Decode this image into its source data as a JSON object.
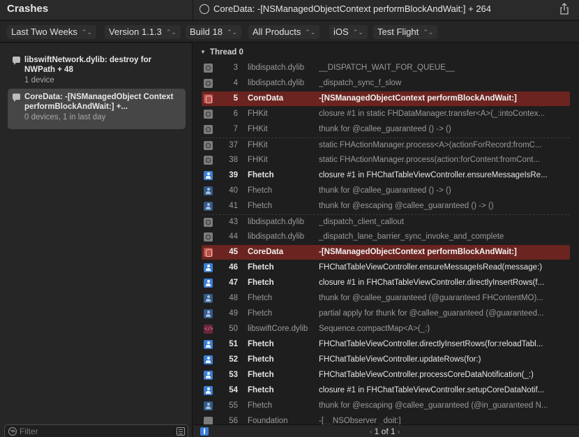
{
  "titlebar": {
    "sidebar_title": "Crashes",
    "crash_title": "CoreData: -[NSManagedObjectContext performBlockAndWait:] + 264"
  },
  "filters": [
    {
      "label": "Last Two Weeks"
    },
    {
      "label": "Version 1.1.3"
    },
    {
      "label": "Build 18"
    },
    {
      "label": "All Products"
    },
    {
      "label": "iOS"
    },
    {
      "label": "Test Flight"
    }
  ],
  "sidebar": {
    "items": [
      {
        "name": "libswiftNetwork.dylib: destroy for NWPath + 48",
        "meta": "1 device",
        "selected": false
      },
      {
        "name": "CoreData: -[NSManagedObject Context performBlockAndWait:] +...",
        "meta": "0 devices, 1 in last day",
        "selected": true
      }
    ],
    "filter_placeholder": "Filter"
  },
  "thread": {
    "title": "Thread 0",
    "frames": [
      {
        "icon": "gear",
        "num": "3",
        "lib": "libdispatch.dylib",
        "sym": "__DISPATCH_WAIT_FOR_QUEUE__",
        "style": "gray"
      },
      {
        "icon": "gear",
        "num": "4",
        "lib": "libdispatch.dylib",
        "sym": "_dispatch_sync_f_slow",
        "style": "gray"
      },
      {
        "icon": "db",
        "num": "5",
        "lib": "CoreData",
        "sym": "-[NSManagedObjectContext performBlockAndWait:]",
        "style": "hl"
      },
      {
        "icon": "gear",
        "num": "6",
        "lib": "FHKit",
        "sym": "closure #1 in static FHDataManager.transfer<A>(_:intoContex...",
        "style": "gray"
      },
      {
        "icon": "gear",
        "num": "7",
        "lib": "FHKit",
        "sym": "thunk for @callee_guaranteed () -> ()",
        "style": "gray"
      },
      {
        "icon": "gear",
        "num": "37",
        "lib": "FHKit",
        "sym": "static FHActionManager.process<A>(actionForRecord:fromC...",
        "style": "gray",
        "sep": true
      },
      {
        "icon": "gear",
        "num": "38",
        "lib": "FHKit",
        "sym": "static FHActionManager.process(action:forContent:fromCont...",
        "style": "gray"
      },
      {
        "icon": "user",
        "num": "39",
        "lib": "Fhetch",
        "sym": "closure #1 in FHChatTableViewController.ensureMessageIsRe...",
        "style": "bright"
      },
      {
        "icon": "user-dim",
        "num": "40",
        "lib": "Fhetch",
        "sym": "thunk for @callee_guaranteed () -> ()",
        "style": "gray"
      },
      {
        "icon": "user-dim",
        "num": "41",
        "lib": "Fhetch",
        "sym": "thunk for @escaping @callee_guaranteed () -> ()",
        "style": "gray"
      },
      {
        "icon": "gear",
        "num": "43",
        "lib": "libdispatch.dylib",
        "sym": "_dispatch_client_callout",
        "style": "gray",
        "sep": true
      },
      {
        "icon": "gear",
        "num": "44",
        "lib": "libdispatch.dylib",
        "sym": "_dispatch_lane_barrier_sync_invoke_and_complete",
        "style": "gray"
      },
      {
        "icon": "db",
        "num": "45",
        "lib": "CoreData",
        "sym": "-[NSManagedObjectContext performBlockAndWait:]",
        "style": "hl"
      },
      {
        "icon": "user",
        "num": "46",
        "lib": "Fhetch",
        "sym": "FHChatTableViewController.ensureMessageIsRead(message:)",
        "style": "bright"
      },
      {
        "icon": "user",
        "num": "47",
        "lib": "Fhetch",
        "sym": "closure #1 in FHChatTableViewController.directlyInsertRows(f...",
        "style": "bright"
      },
      {
        "icon": "user-dim",
        "num": "48",
        "lib": "Fhetch",
        "sym": "thunk for @callee_guaranteed (@guaranteed FHContentMO)...",
        "style": "gray"
      },
      {
        "icon": "user-dim",
        "num": "49",
        "lib": "Fhetch",
        "sym": "partial apply for thunk for @callee_guaranteed (@guaranteed...",
        "style": "gray"
      },
      {
        "icon": "swift",
        "num": "50",
        "lib": "libswiftCore.dylib",
        "sym": "Sequence.compactMap<A>(_:)",
        "style": "gray"
      },
      {
        "icon": "user",
        "num": "51",
        "lib": "Fhetch",
        "sym": "FHChatTableViewController.directlyInsertRows(for:reloadTabl...",
        "style": "bright"
      },
      {
        "icon": "user",
        "num": "52",
        "lib": "Fhetch",
        "sym": "FHChatTableViewController.updateRows(for:)",
        "style": "bright"
      },
      {
        "icon": "user",
        "num": "53",
        "lib": "Fhetch",
        "sym": "FHChatTableViewController.processCoreDataNotification(_:)",
        "style": "bright"
      },
      {
        "icon": "user",
        "num": "54",
        "lib": "Fhetch",
        "sym": "closure #1 in FHChatTableViewController.setupCoreDataNotif...",
        "style": "bright"
      },
      {
        "icon": "user-dim",
        "num": "55",
        "lib": "Fhetch",
        "sym": "thunk for @escaping @callee_guaranteed (@in_guaranteed N...",
        "style": "gray"
      },
      {
        "icon": "folder",
        "num": "56",
        "lib": "Foundation",
        "sym": "-[__NSObserver _doit:]",
        "style": "gray"
      }
    ]
  },
  "pager": {
    "text": "1 of 1"
  }
}
